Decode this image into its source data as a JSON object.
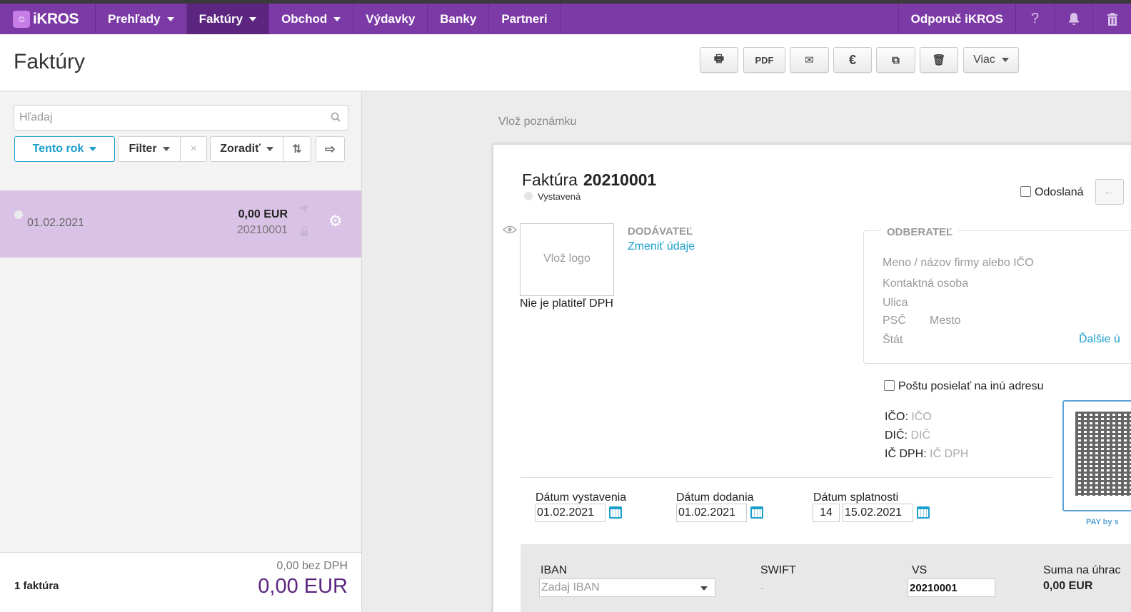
{
  "nav": {
    "logo": "iKROS",
    "items": [
      {
        "label": "Prehľady",
        "dropdown": true
      },
      {
        "label": "Faktúry",
        "dropdown": true,
        "active": true
      },
      {
        "label": "Obchod",
        "dropdown": true
      },
      {
        "label": "Výdavky"
      },
      {
        "label": "Banky"
      },
      {
        "label": "Partneri"
      }
    ],
    "refer": "Odporuč iKROS",
    "icons": [
      "help-icon",
      "bell-icon",
      "trash-icon"
    ]
  },
  "header": {
    "title": "Faktúry",
    "toolbar": {
      "print": "🖶",
      "pdf": "PDF",
      "email": "✉",
      "euro": "€",
      "copy": "⧉",
      "delete": "🗑",
      "more": "Viac"
    }
  },
  "list": {
    "search_placeholder": "Hľadaj",
    "filters": {
      "period": "Tento rok",
      "filter": "Filter",
      "clear": "×",
      "sort": "Zoradiť",
      "sort_dir": "⇅",
      "export": "⇨"
    },
    "rows": [
      {
        "date": "01.02.2021",
        "amount": "0,00 EUR",
        "number": "20210001"
      }
    ],
    "footer": {
      "count": "1 faktúra",
      "net": "0,00 bez DPH",
      "total": "0,00 EUR"
    }
  },
  "invoice": {
    "note_link": "Vlož poznámku",
    "title_label": "Faktúra",
    "number": "20210001",
    "status": "Vystavená",
    "sent_label": "Odoslaná",
    "logo_placeholder": "Vlož logo",
    "vat_note": "Nie je platiteľ DPH",
    "supplier": {
      "heading": "DODÁVATEĽ",
      "change_link": "Zmeniť údaje"
    },
    "customer": {
      "heading": "ODBERATEĽ",
      "name": "Meno / názov firmy alebo IČO",
      "contact": "Kontaktná osoba",
      "street": "Ulica",
      "zip": "PSČ",
      "city": "Mesto",
      "country": "Štát",
      "more_link": "Ďalšie ú"
    },
    "post_alt": "Poštu posielať na inú adresu",
    "ids": [
      {
        "label": "IČO:",
        "placeholder": "IČO"
      },
      {
        "label": "DIČ:",
        "placeholder": "DIČ"
      },
      {
        "label": "IČ DPH:",
        "placeholder": "IČ DPH"
      }
    ],
    "qr_label": "PAY by s",
    "dates": {
      "issue_label": "Dátum vystavenia",
      "issue": "01.02.2021",
      "delivery_label": "Dátum dodania",
      "delivery": "01.02.2021",
      "due_label": "Dátum splatnosti",
      "due_days": "14",
      "due": "15.02.2021"
    },
    "payment": {
      "iban_label": "IBAN",
      "iban_placeholder": "Zadaj IBAN",
      "swift_label": "SWIFT",
      "swift_value": "-",
      "vs_label": "VS",
      "vs": "20210001",
      "sum_label": "Suma na úhrac",
      "sum": "0,00 EUR"
    }
  },
  "colors": {
    "brand": "#7c3aa6",
    "brand_dark": "#5b2580",
    "accent": "#1a9ecd",
    "selected_row": "#d9c2e6"
  }
}
